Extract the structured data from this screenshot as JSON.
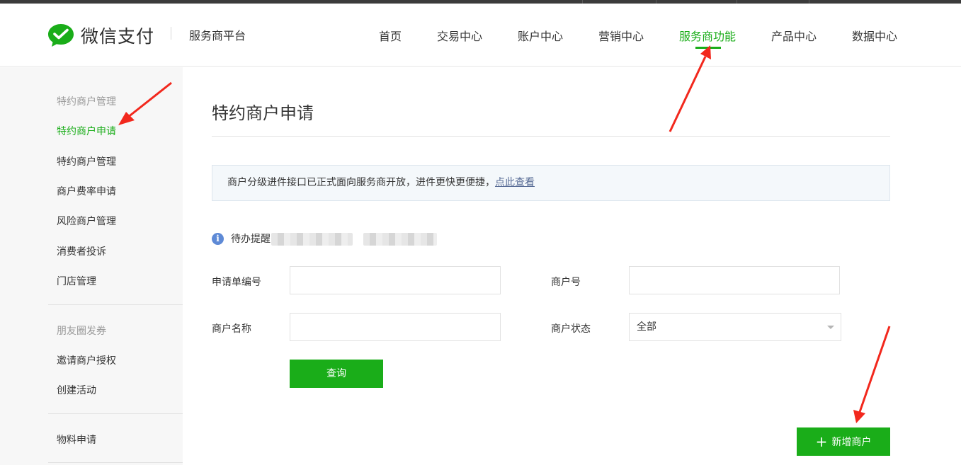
{
  "header": {
    "logo_text": "微信支付",
    "platform": "服务商平台",
    "nav": [
      "首页",
      "交易中心",
      "账户中心",
      "营销中心",
      "服务商功能",
      "产品中心",
      "数据中心"
    ],
    "active_nav": "服务商功能"
  },
  "sidebar": {
    "group1_title": "特约商户管理",
    "group1_items": [
      "特约商户申请",
      "特约商户管理",
      "商户费率申请",
      "风险商户管理",
      "消费者投诉",
      "门店管理"
    ],
    "group2_title": "朋友圈发券",
    "group2_items": [
      "邀请商户授权",
      "创建活动"
    ],
    "group3_items": [
      "物料申请"
    ],
    "active_item": "特约商户申请"
  },
  "main": {
    "title": "特约商户申请",
    "notice_text": "商户分级进件接口已正式面向服务商开放，进件更快更便捷，",
    "notice_link": "点此查看",
    "todo_icon": "i",
    "todo_label": "待办提醒",
    "form": {
      "application_no_label": "申请单编号",
      "merchant_no_label": "商户号",
      "merchant_name_label": "商户名称",
      "merchant_status_label": "商户状态",
      "merchant_status_value": "全部",
      "application_no_value": "",
      "merchant_no_value": "",
      "merchant_name_value": ""
    },
    "query_button": "查询",
    "add_button_icon": "+",
    "add_button": "新增商户"
  },
  "colors": {
    "accent": "#1aad19",
    "link": "#576b95",
    "annotation_arrow": "#f2281d"
  }
}
